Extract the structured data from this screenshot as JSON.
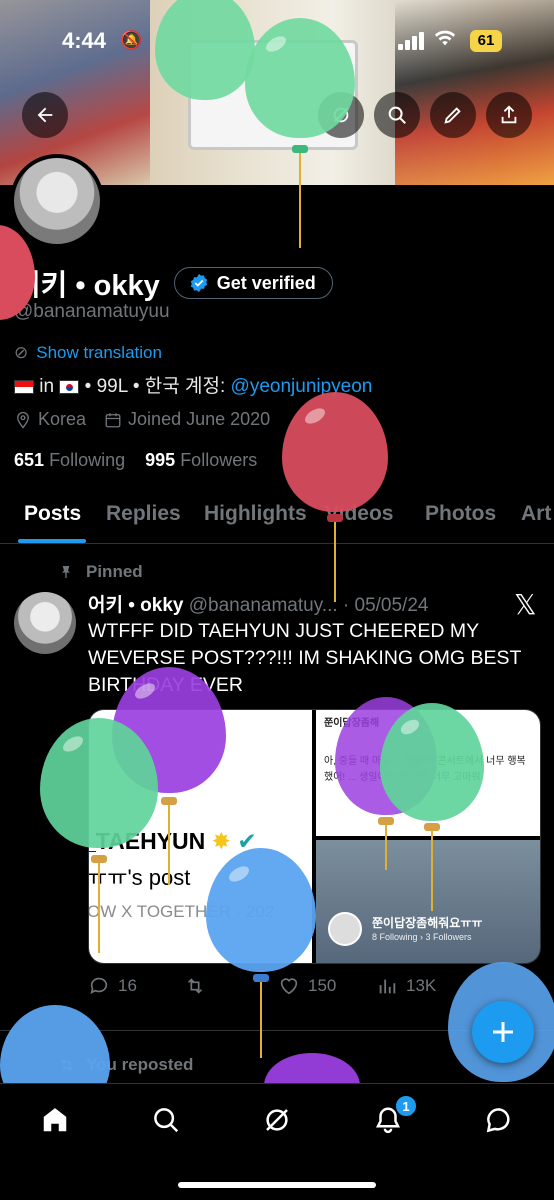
{
  "status_bar": {
    "time": "4:44",
    "battery": "61"
  },
  "profile": {
    "name": "어키 • okky",
    "get_verified": "Get verified",
    "handle": "@bananamatuyuu",
    "show_translation": "Show translation",
    "bio_prefix": "in",
    "bio_middle": "• 99L • 한국 계정:",
    "bio_mention": "@yeonjunipyeon",
    "location": "Korea",
    "joined": "Joined June 2020",
    "following_count": "651",
    "following_label": "Following",
    "followers_count": "995",
    "followers_label": "Followers"
  },
  "tabs": [
    "Posts",
    "Replies",
    "Highlights",
    "Videos",
    "Photos",
    "Art"
  ],
  "post": {
    "pinned_label": "Pinned",
    "author": "어키 • okky",
    "handle_date": "@bananamatuy... · 05/05/24",
    "text": "WTFFF DID TAEHYUN JUST CHEERED MY WEVERSE POST???!!! IM SHAKING OMG BEST BIRTHDAY EVER",
    "media": {
      "left_line1": "_TAEHYUN",
      "left_line2": "ㅠㅠ's post",
      "left_line3": "OW X TOGETHER · 202",
      "top_right_title": "쭌이답장좀해",
      "top_right_text": "아, 중들 때 마음 ... 생일 때 콘서트에서 너무 행복했어! ... 생일이었어! 너무 너무 고마워",
      "bottom_right_name": "쭌이답장좀해줘요ㅠㅠ",
      "bottom_right_stats": "8 Following › 3 Followers"
    },
    "replies": "16",
    "reposts": "",
    "likes": "150",
    "views": "13K"
  },
  "reposted_label": "You reposted",
  "nav": {
    "notifications_badge": "1"
  }
}
